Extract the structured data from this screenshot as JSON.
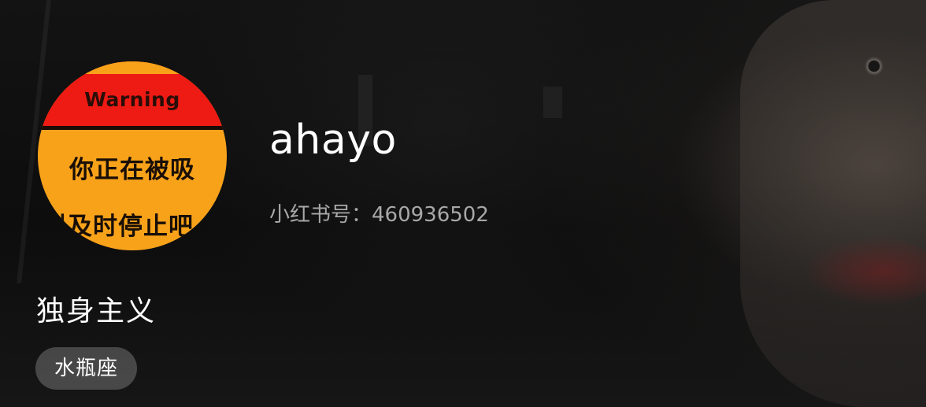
{
  "profile": {
    "avatar": {
      "warning_text": "Warning",
      "line1": "你正在被吸",
      "line2": "引及时停止吧",
      "colors": {
        "top": "#ee1a14",
        "bottom": "#f8a21a"
      }
    },
    "username": "ahayo",
    "account_id_label": "小红书号：",
    "account_id": "460936502",
    "bio": "独身主义",
    "tags": [
      "水瓶座"
    ]
  }
}
